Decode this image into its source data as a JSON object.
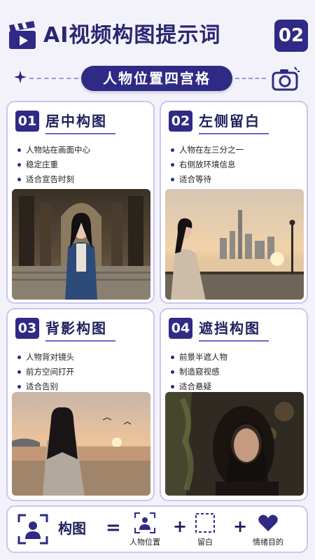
{
  "header": {
    "title": "AI视频构图提示词",
    "number": "02"
  },
  "subtitle": "人物位置四宫格",
  "cards": [
    {
      "num": "01",
      "title": "居中构图",
      "bullets": [
        "人物站在画面中心",
        "稳定庄重",
        "适合宣告时刻"
      ]
    },
    {
      "num": "02",
      "title": "左侧留白",
      "bullets": [
        "人物在左三分之一",
        "右侧放环境信息",
        "适合等待"
      ]
    },
    {
      "num": "03",
      "title": "背影构图",
      "bullets": [
        "人物背对镜头",
        "前方空间打开",
        "适合告别"
      ]
    },
    {
      "num": "04",
      "title": "遮挡构图",
      "bullets": [
        "前景半遮人物",
        "制造窥视感",
        "适合悬疑"
      ]
    }
  ],
  "formula": {
    "label": "构图",
    "equals": "=",
    "plus": "+",
    "items": [
      "人物位置",
      "留白",
      "情绪目的"
    ]
  },
  "colors": {
    "accent": "#2f2a86",
    "background": "#f3f2fb",
    "border": "#c9c6ee"
  },
  "icons": [
    "clapperboard-icon",
    "sparkle-icon",
    "camera-icon",
    "person-frame-icon",
    "dashed-square-icon",
    "heart-icon"
  ]
}
